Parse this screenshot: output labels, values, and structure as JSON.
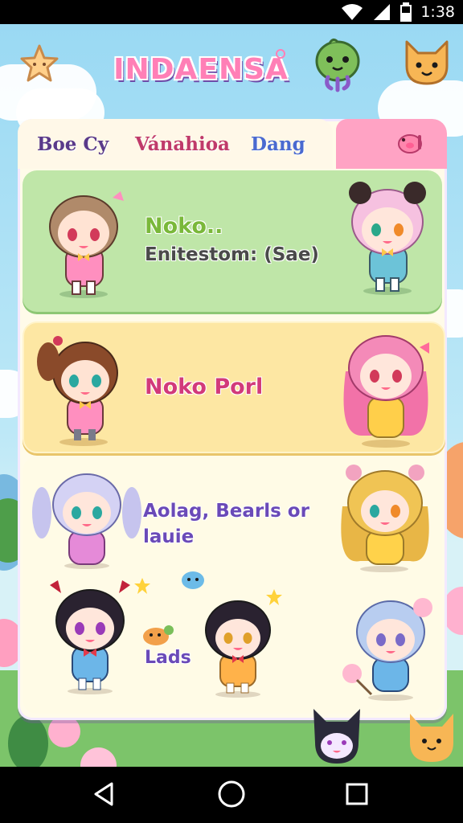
{
  "status_bar": {
    "time": "1:38",
    "icons": [
      "wifi-icon",
      "signal-icon",
      "battery-icon"
    ]
  },
  "header": {
    "logo_text": "INDAENSA",
    "left_icon": "star-icon",
    "right_icons": [
      "green-blob-mascot-icon",
      "orange-fox-icon"
    ]
  },
  "tabs": [
    {
      "label": "Boe Cy",
      "color": "#5a3a8a"
    },
    {
      "label": "Vánahioa",
      "color": "#c03a6a"
    },
    {
      "label": "Dang",
      "color": "#4a6ad0"
    },
    {
      "label": "",
      "icon": "pig-face-icon",
      "active": true
    }
  ],
  "cards": [
    {
      "name": "Noko..",
      "subtitle": "Enitestom: (Sae)",
      "background": "#bfe6a8"
    },
    {
      "name": "Noko Porl",
      "background": "#fde7a3"
    },
    {
      "name": "Aolag, Bearls or lauie",
      "footer": "Lads",
      "background": "#fffbe6"
    }
  ],
  "colors": {
    "accent_pink": "#ffa3c4",
    "panel": "#fffbe9",
    "sky": "#9ad9f3",
    "grass": "#7cc46a"
  },
  "nav_bar": {
    "buttons": [
      "back-icon",
      "home-icon",
      "recents-icon"
    ]
  }
}
